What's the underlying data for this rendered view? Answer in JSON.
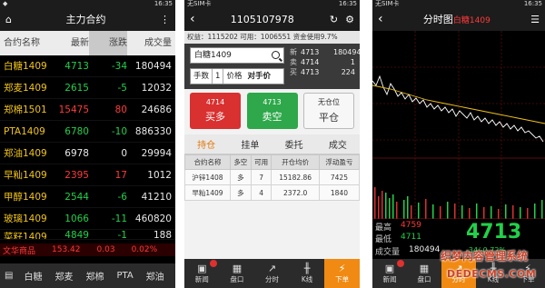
{
  "phone1": {
    "status_left": "◆",
    "status_time": "16:35",
    "title": "主力合约",
    "columns": [
      "合约名称",
      "最新",
      "涨跌",
      "成交量"
    ],
    "rows": [
      {
        "name": "白糖1409",
        "last": "4713",
        "chg": "-34",
        "vol": "180494",
        "dir": "down"
      },
      {
        "name": "郑麦1409",
        "last": "2615",
        "chg": "-5",
        "vol": "12032",
        "dir": "down"
      },
      {
        "name": "郑棉1501",
        "last": "15475",
        "chg": "80",
        "vol": "24686",
        "dir": "up"
      },
      {
        "name": "PTA1409",
        "last": "6780",
        "chg": "-10",
        "vol": "886330",
        "dir": "down"
      },
      {
        "name": "郑油1409",
        "last": "6978",
        "chg": "0",
        "vol": "29994",
        "dir": "flat"
      },
      {
        "name": "早籼1409",
        "last": "2395",
        "chg": "17",
        "vol": "1012",
        "dir": "up"
      },
      {
        "name": "甲醇1409",
        "last": "2544",
        "chg": "-6",
        "vol": "41210",
        "dir": "down"
      },
      {
        "name": "玻璃1409",
        "last": "1066",
        "chg": "-11",
        "vol": "460820",
        "dir": "down"
      },
      {
        "name": "菜籽1409",
        "last": "4849",
        "chg": "-1",
        "vol": "188",
        "dir": "down"
      }
    ],
    "ticker": [
      "文华商品",
      "153.42",
      "0.03",
      "0.02%"
    ],
    "tabs": [
      "白糖",
      "郑麦",
      "郑棉",
      "PTA",
      "郑油"
    ]
  },
  "phone2": {
    "status_left": "无SIM卡",
    "status_time": "16:35",
    "title": "1105107978",
    "account": "权益：1115202  可用：1006551  资金使用9.7%",
    "search_value": "白糖1409",
    "qty_label": "手数",
    "qty_value": "1",
    "price_label": "价格",
    "price_value": "对手价",
    "quotes": [
      {
        "k": "新",
        "p": "4713",
        "v": "180494"
      },
      {
        "k": "卖",
        "p": "4714",
        "v": "1"
      },
      {
        "k": "买",
        "p": "4713",
        "v": "224"
      }
    ],
    "buy_price": "4714",
    "buy_label": "买多",
    "sell_price": "4713",
    "sell_label": "卖空",
    "close_price": "无仓位",
    "close_label": "平仓",
    "subtabs": [
      "持仓",
      "挂单",
      "委托",
      "成交"
    ],
    "table_headers": [
      "合约名称",
      "多空",
      "可用",
      "开仓均价",
      "浮动盈亏"
    ],
    "positions": [
      [
        "沪锌1408",
        "多",
        "7",
        "15182.86",
        "7425"
      ],
      [
        "早籼1409",
        "多",
        "4",
        "2372.0",
        "1840"
      ]
    ],
    "nav": [
      "新闻",
      "盘口",
      "分时",
      "K线",
      "下单"
    ]
  },
  "phone3": {
    "status_left": "无SIM卡",
    "status_time": "16:35",
    "title": "分时图",
    "title_contract": "白糖1409",
    "high_label": "最高",
    "high_value": "4759",
    "low_label": "最低",
    "low_value": "4711",
    "vol_label": "成交量",
    "vol_value": "180494",
    "last_price": "4713",
    "change": "-34/-0.72%",
    "nav": [
      "新闻",
      "盘口",
      "分时",
      "K线",
      "下单"
    ]
  },
  "watermark": {
    "line1": "织梦内容管理系统",
    "line2": "DEDECMS.COM"
  },
  "colors": {
    "up": "#ff3a3a",
    "down": "#22d04a",
    "accent": "#f08a12",
    "symbol": "#f0c419"
  }
}
